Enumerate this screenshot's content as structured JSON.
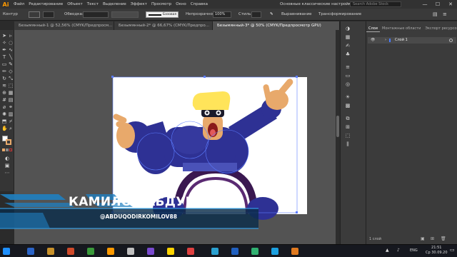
{
  "app": {
    "logo": "Ai"
  },
  "menu": [
    "Файл",
    "Редактирование",
    "Объект",
    "Текст",
    "Выделение",
    "Эффект",
    "Просмотр",
    "Окно",
    "Справка"
  ],
  "workspace": "Основные классические настройки",
  "search": {
    "placeholder": "Search Adobe Stock"
  },
  "window_controls": {
    "minimize": "—",
    "maximize": "☐",
    "close": "✕"
  },
  "control_bar": {
    "left_label": "Контур",
    "stroke_label": "Обводка:",
    "brush_label": "Базовая",
    "opacity_label": "Непрозрачность:",
    "opacity_value": "100%",
    "style_label": "Стиль:",
    "align_label": "Выравнивание",
    "transform_label": "Трансформирование"
  },
  "tabs": [
    {
      "label": "Безымянный-1 @ 52,56% (CMYK/Предпросм...",
      "active": false
    },
    {
      "label": "Безымянный-2* @ 66,67% (CMYK/Предпро...",
      "active": false
    },
    {
      "label": "Безымянный-3* @ 50% (CMYK/Предпросмотр GPU)",
      "active": true
    }
  ],
  "layers_panel": {
    "tabs": [
      "Слои",
      "Монтажные области",
      "Экспорт ресурсов"
    ],
    "active_tab": 0,
    "layer_name": "Слой 1",
    "footer": "1 слой"
  },
  "banner": {
    "name": "КАМИЛОВ АБДУКАДИР",
    "handle": "@ABDUQODIRKOMILOV88"
  },
  "taskbar": {
    "lang": "ENG",
    "time": "21:51",
    "date": "Ср 30.09.20"
  },
  "icons": {
    "tools": [
      "selection-arrow-icon",
      "direct-selection-icon",
      "magic-wand-icon",
      "lasso-icon",
      "pen-icon",
      "curvature-icon",
      "type-icon",
      "line-icon",
      "rectangle-icon",
      "paintbrush-icon",
      "pencil-icon",
      "eraser-icon",
      "rotate-icon",
      "scale-icon",
      "width-icon",
      "free-transform-icon",
      "shape-builder-icon",
      "perspective-icon",
      "mesh-icon",
      "gradient-icon",
      "eyedropper-icon",
      "blend-icon",
      "symbol-sprayer-icon",
      "graph-icon",
      "artboard-icon",
      "slice-icon",
      "hand-icon",
      "zoom-icon"
    ],
    "panels": [
      "color-panel-icon",
      "swatches-icon",
      "brushes-icon",
      "symbols-icon",
      "stroke-icon",
      "gradient-panel-icon",
      "transparency-icon",
      "appearance-icon",
      "graphic-styles-icon",
      "layers-panel-icon",
      "pathfinder-icon",
      "transform-panel-icon",
      "align-panel-icon"
    ]
  },
  "colors": {
    "accent": "#ff9a00",
    "character_blue": "#2e3194",
    "skin": "#e8a96b",
    "hair": "#ffe45a",
    "banner_blue": "#1f7fc0"
  }
}
